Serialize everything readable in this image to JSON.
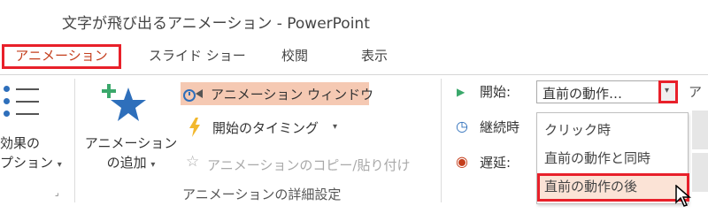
{
  "window": {
    "title": "文字が飛び出るアニメーション - PowerPoint"
  },
  "tabs": [
    {
      "label": "アニメーション",
      "active": true
    },
    {
      "label": "スライド ショー",
      "active": false
    },
    {
      "label": "校閲",
      "active": false
    },
    {
      "label": "表示",
      "active": false
    }
  ],
  "ribbon": {
    "effect_options": {
      "line1": "効果の",
      "line2": "プション",
      "arrow": "▾"
    },
    "add_animation": {
      "line1": "アニメーション",
      "line2": "の追加",
      "arrow": "▾"
    },
    "advanced": {
      "animation_pane": "アニメーション ウィンドウ",
      "trigger": "開始のタイミング",
      "trigger_arrow": "▾",
      "painter": "アニメーションのコピー/貼り付け",
      "group_label": "アニメーションの詳細設定"
    },
    "timing": {
      "start_label": "開始:",
      "start_value": "直前の動作…",
      "duration_label": "継続時",
      "delay_label": "遅延:",
      "next_label_partial": "ア",
      "dropdown_arrow": "▾"
    },
    "dropdown_options": [
      {
        "label": "クリック時",
        "selected": false
      },
      {
        "label": "直前の動作と同時",
        "selected": false
      },
      {
        "label": "直前の動作の後",
        "selected": true
      }
    ]
  },
  "colors": {
    "highlight_red": "#e8202a",
    "accent_orange": "#c43e1c",
    "pane_highlight": "#f5c9b3",
    "star_blue": "#2e6fbb",
    "plus_green": "#3aa86b"
  }
}
